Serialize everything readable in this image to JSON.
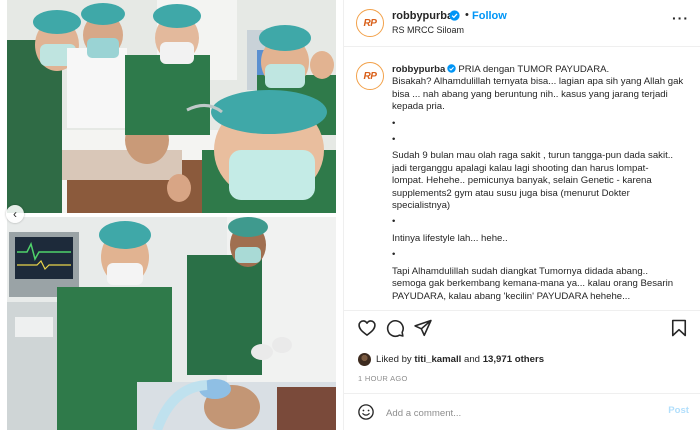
{
  "post": {
    "username": "robbypurba",
    "avatar_initials": "RP",
    "follow_label": "Follow",
    "separator": "•",
    "location": "RS MRCC Siloam",
    "more_label": "···"
  },
  "caption": {
    "username": "robbypurba",
    "lines": [
      "PRIA dengan TUMOR PAYUDARA.",
      "Bisakah? Alhamdulillah ternyata bisa... lagian apa sih yang Allah gak",
      "bisa ... nah abang yang beruntung nih.. kasus yang jarang terjadi",
      "kepada pria.",
      "•",
      "•",
      "Sudah 9 bulan mau olah raga sakit , turun tangga-pun dada sakit..",
      "jadi terganggu apalagi kalau lagi shooting dan harus lompat-",
      "lompat. Hehehe.. pemicunya banyak, selain Genetic - karena",
      "supplements2 gym atau susu juga bisa (menurut Dokter",
      "specialistnya)",
      "•",
      "Intinya lifestyle lah... hehe..",
      "•",
      "Tapi Alhamdulillah sudah diangkat Tumornya didada abang..",
      "semoga gak berkembang kemana-mana ya... kalau orang Besarin",
      "PAYUDARA, kalau abang 'kecilin' PAYUDARA hehehe..."
    ]
  },
  "likes": {
    "prefix": "Liked by",
    "first_user": "titi_kamall",
    "conjunction": "and",
    "others": "13,971 others"
  },
  "timestamp": "1 HOUR AGO",
  "comment": {
    "placeholder": "Add a comment...",
    "post_label": "Post"
  },
  "carousel": {
    "prev_label": "‹"
  },
  "icons": {
    "verified": "verified-badge-icon",
    "like": "heart-icon",
    "comment": "comment-bubble-icon",
    "share": "paper-plane-icon",
    "save": "bookmark-icon",
    "emoji": "smiley-icon"
  },
  "colors": {
    "accent": "#0095f6",
    "text": "#262626",
    "muted": "#8e8e8e",
    "avatar_ring": "#f2a14a",
    "scrubs": "#2f7a4a",
    "cap": "#3fa8a8"
  }
}
